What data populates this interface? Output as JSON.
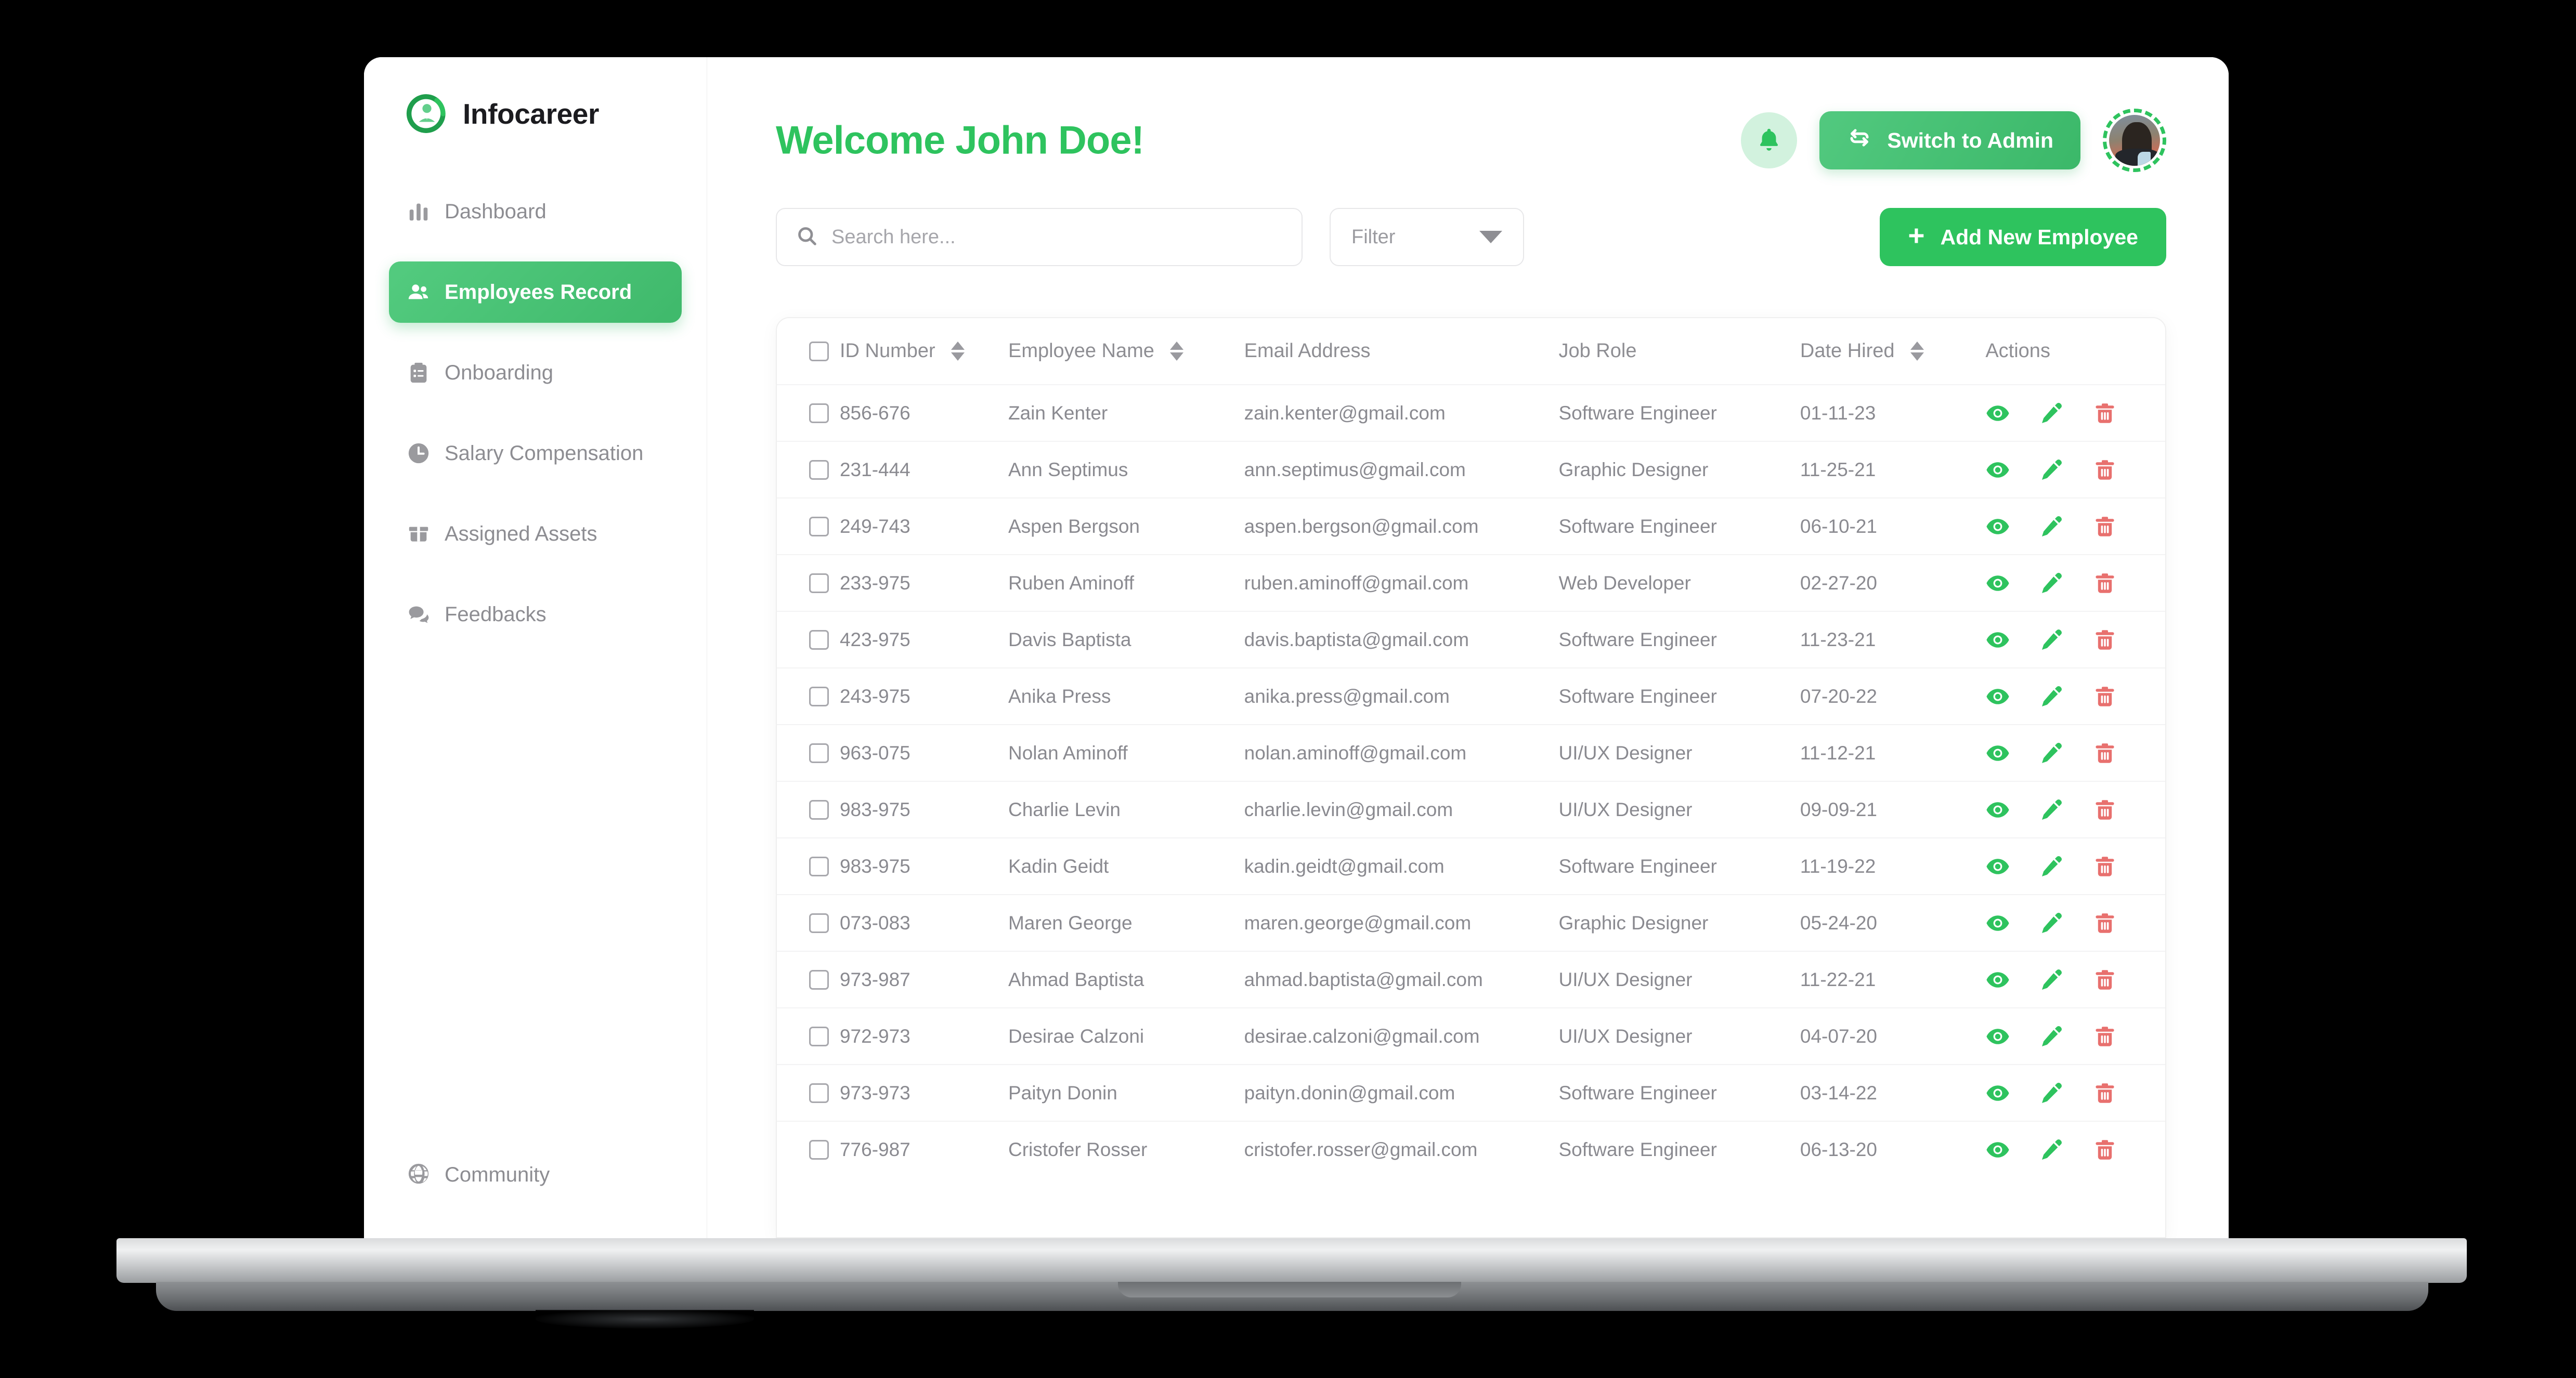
{
  "brand": {
    "name": "Infocareer",
    "logo_icon": "infocareer-logo"
  },
  "sidebar": {
    "items": [
      {
        "label": "Dashboard",
        "icon": "bar-chart-icon",
        "active": false
      },
      {
        "label": "Employees Record",
        "icon": "people-icon",
        "active": true
      },
      {
        "label": "Onboarding",
        "icon": "clipboard-icon",
        "active": false
      },
      {
        "label": "Salary Compensation",
        "icon": "clock-icon",
        "active": false
      },
      {
        "label": "Assigned Assets",
        "icon": "box-icon",
        "active": false
      },
      {
        "label": "Feedbacks",
        "icon": "chat-bubble-icon",
        "active": false
      }
    ],
    "footer": {
      "label": "Community",
      "icon": "globe-icon"
    }
  },
  "header": {
    "title": "Welcome John Doe!",
    "notification_icon": "bell-icon",
    "switch_admin_label": "Switch to Admin",
    "switch_admin_icon": "swap-arrows-icon",
    "avatar_icon": "user-avatar"
  },
  "toolbar": {
    "search_placeholder": "Search here...",
    "search_value": "",
    "search_icon": "search-icon",
    "filter_label": "Filter",
    "filter_caret_icon": "chevron-down-icon",
    "add_employee_label": "Add New Employee",
    "add_employee_icon": "plus-icon"
  },
  "table": {
    "columns": [
      {
        "key": "checkbox",
        "label": "",
        "sortable": false
      },
      {
        "key": "id",
        "label": "ID Number",
        "sortable": true
      },
      {
        "key": "name",
        "label": "Employee Name",
        "sortable": true
      },
      {
        "key": "email",
        "label": "Email Address",
        "sortable": false
      },
      {
        "key": "role",
        "label": "Job Role",
        "sortable": false
      },
      {
        "key": "date",
        "label": "Date Hired",
        "sortable": true
      },
      {
        "key": "actions",
        "label": "Actions",
        "sortable": false
      }
    ],
    "action_icons": [
      "eye-icon",
      "pencil-icon",
      "trash-icon"
    ],
    "rows": [
      {
        "id": "856-676",
        "name": "Zain Kenter",
        "email": "zain.kenter@gmail.com",
        "role": "Software Engineer",
        "date": "01-11-23"
      },
      {
        "id": "231-444",
        "name": "Ann Septimus",
        "email": "ann.septimus@gmail.com",
        "role": "Graphic Designer",
        "date": "11-25-21"
      },
      {
        "id": "249-743",
        "name": "Aspen Bergson",
        "email": "aspen.bergson@gmail.com",
        "role": "Software Engineer",
        "date": "06-10-21"
      },
      {
        "id": "233-975",
        "name": "Ruben Aminoff",
        "email": "ruben.aminoff@gmail.com",
        "role": "Web Developer",
        "date": "02-27-20"
      },
      {
        "id": "423-975",
        "name": "Davis Baptista",
        "email": "davis.baptista@gmail.com",
        "role": "Software Engineer",
        "date": "11-23-21"
      },
      {
        "id": "243-975",
        "name": "Anika Press",
        "email": "anika.press@gmail.com",
        "role": "Software Engineer",
        "date": "07-20-22"
      },
      {
        "id": "963-075",
        "name": "Nolan Aminoff",
        "email": "nolan.aminoff@gmail.com",
        "role": "UI/UX Designer",
        "date": "11-12-21"
      },
      {
        "id": "983-975",
        "name": "Charlie Levin",
        "email": "charlie.levin@gmail.com",
        "role": "UI/UX Designer",
        "date": "09-09-21"
      },
      {
        "id": "983-975",
        "name": "Kadin Geidt",
        "email": "kadin.geidt@gmail.com",
        "role": "Software Engineer",
        "date": "11-19-22"
      },
      {
        "id": "073-083",
        "name": "Maren George",
        "email": "maren.george@gmail.com",
        "role": "Graphic Designer",
        "date": "05-24-20"
      },
      {
        "id": "973-987",
        "name": "Ahmad Baptista",
        "email": "ahmad.baptista@gmail.com",
        "role": "UI/UX Designer",
        "date": "11-22-21"
      },
      {
        "id": "972-973",
        "name": "Desirae Calzoni",
        "email": "desirae.calzoni@gmail.com",
        "role": "UI/UX Designer",
        "date": "04-07-20"
      },
      {
        "id": "973-973",
        "name": "Paityn Donin",
        "email": "paityn.donin@gmail.com",
        "role": "Software Engineer",
        "date": "03-14-22"
      },
      {
        "id": "776-987",
        "name": "Cristofer Rosser",
        "email": "cristofer.rosser@gmail.com",
        "role": "Software Engineer",
        "date": "06-13-20"
      }
    ]
  },
  "colors": {
    "brand_green": "#2ec35e",
    "accent_green_dark": "#3bb869",
    "delete_red": "#e8706e",
    "text_muted": "#8a8a90",
    "bezel_black": "#000000"
  }
}
